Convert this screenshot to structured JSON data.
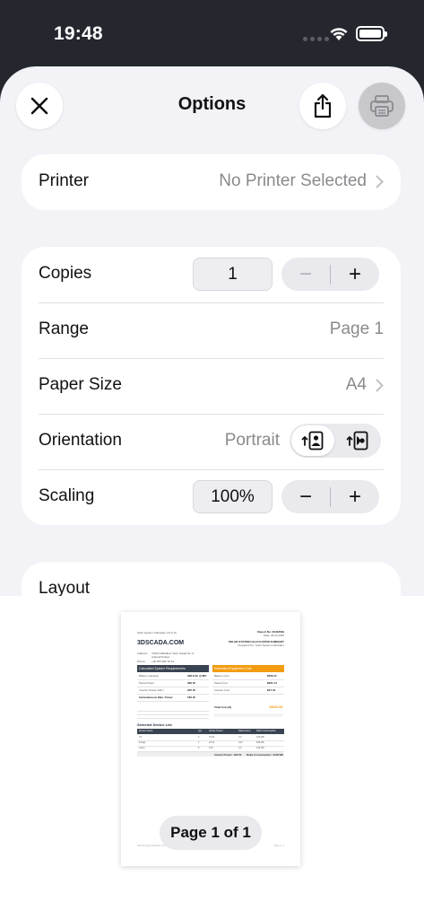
{
  "status": {
    "time": "19:48"
  },
  "header": {
    "title": "Options"
  },
  "printer": {
    "label": "Printer",
    "value": "No Printer Selected"
  },
  "copies": {
    "label": "Copies",
    "value": "1",
    "minus": "−",
    "plus": "+"
  },
  "range": {
    "label": "Range",
    "value": "Page 1"
  },
  "paper_size": {
    "label": "Paper Size",
    "value": "A4"
  },
  "orientation": {
    "label": "Orientation",
    "value": "Portrait",
    "options": [
      "portrait-icon",
      "landscape-icon"
    ],
    "selected": "portrait"
  },
  "scaling": {
    "label": "Scaling",
    "value": "100%",
    "minus": "−",
    "plus": "+"
  },
  "layout": {
    "label": "Layout"
  },
  "preview": {
    "page_indicator": "Page 1 of 1",
    "doc": {
      "top_left": "Solar System Calculator (V1.0.0)",
      "report_no": "Report No: 84433539",
      "report_date": "Date: 26.10.2025",
      "brand": "3DSCADA.COM",
      "summary_title": "SOLAR SYSTEM CALCULATION SUMMARY",
      "prepared_for": "Prepared For: Solar System Calculator",
      "address_label": "Address:",
      "address": "Yildizli Mahallesi Yasin Sokak No: 9",
      "city": "Ankara/Türkiye",
      "phone_label": "Phone:",
      "phone": "+90 553 896 78 32",
      "req_title": "Calculated System Requirements",
      "req_rows": [
        [
          "Battery Capacity",
          "338.8 Ah @48V"
        ],
        [
          "Panel Power",
          "369 W"
        ],
        [
          "Inverter Power (Min.)",
          "225 W"
        ],
        [
          "Instantaneous Max. Power",
          "180 W"
        ]
      ],
      "cost_title": "Estimated Equipment Cost",
      "cost_rows": [
        [
          "Battery Cost",
          "$506.47"
        ],
        [
          "Panel Cost",
          "$261.14"
        ],
        [
          "Inverter Cost",
          "$47.44"
        ]
      ],
      "total_label": "Total Cost ($)",
      "total_value": "$815.05",
      "device_title": "Selected Device List",
      "device_headers": [
        "Device Name",
        "Qty",
        "Hourly Power",
        "Daily Hours",
        "Daily Consumption"
      ],
      "device_rows": [
        [
          "TV",
          "1",
          "70 W",
          "4 h",
          "143 Wh"
        ],
        [
          "Fridge",
          "1",
          "22 W",
          "24 h",
          "528 Wh"
        ],
        [
          "Lamp",
          "6",
          "6 W",
          "4 h",
          "144 Wh"
        ]
      ],
      "total_power": "Instant Power: 180 W",
      "daily_consumption": "Daily Consumption: 1148 Wh",
      "footer_left": "Solar Energy Calculator (V1.0.0)",
      "footer_right": "Page 1 / 1"
    }
  },
  "colors": {
    "req_header": "#3a4351",
    "cost_header": "#f39c12",
    "total": "#f39c12"
  }
}
